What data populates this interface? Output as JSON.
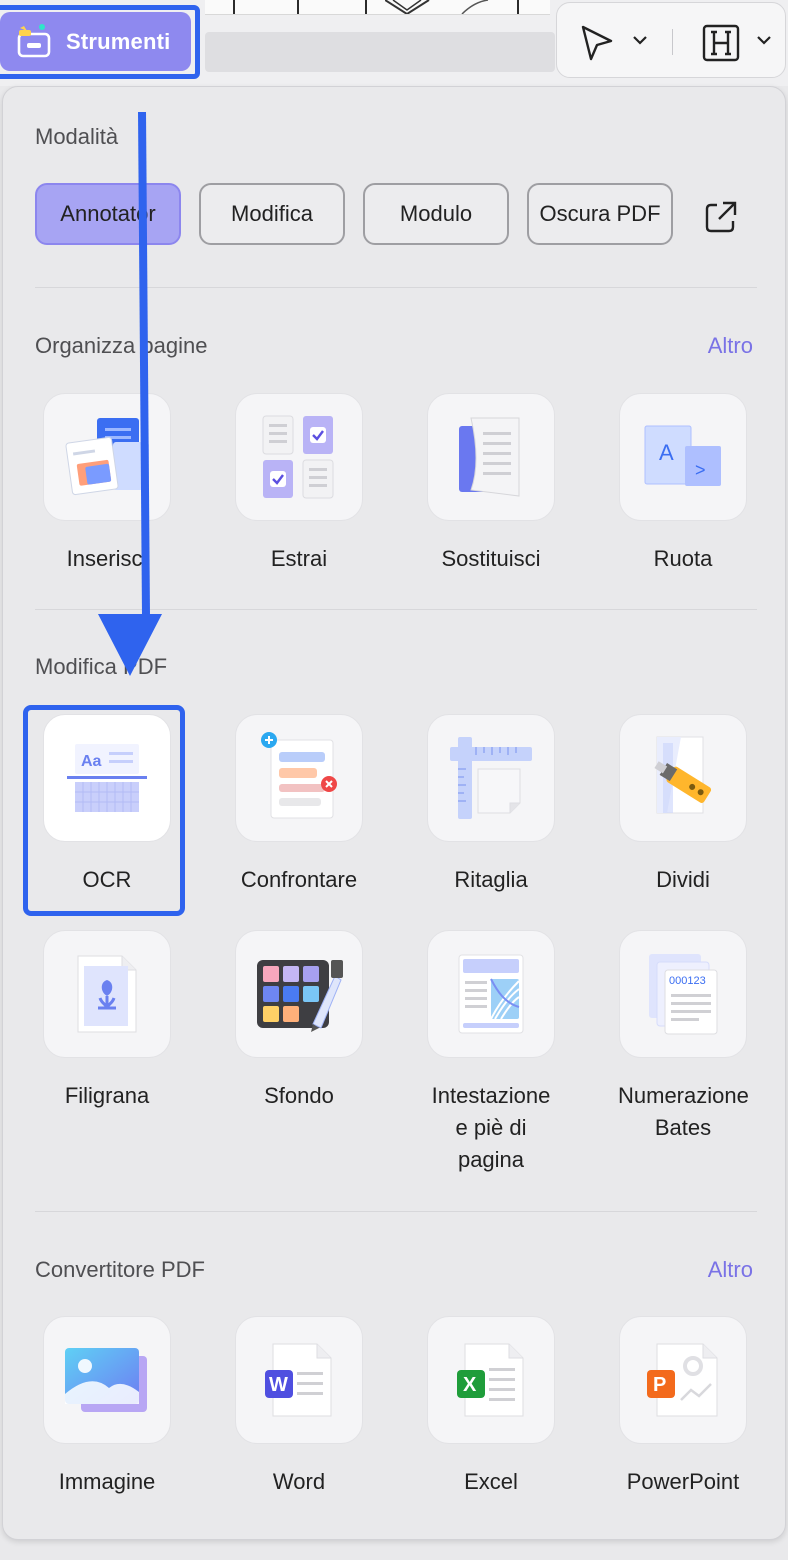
{
  "toolbar": {
    "strumenti_label": "Strumenti"
  },
  "panel": {
    "modes": {
      "title": "Modalità",
      "buttons": [
        "Annotator",
        "Modifica",
        "Modulo",
        "Oscura PDF"
      ],
      "active": "Annotator"
    },
    "organize": {
      "title": "Organizza pagine",
      "more": "Altro",
      "items": [
        "Inserisci",
        "Estrai",
        "Sostituisci",
        "Ruota"
      ]
    },
    "edit": {
      "title": "Modifica PDF",
      "items": [
        "OCR",
        "Confrontare",
        "Ritaglia",
        "Dividi",
        "Filigrana",
        "Sfondo",
        "Intestazione e piè di pagina",
        "Numerazione Bates"
      ]
    },
    "convert": {
      "title": "Convertitore PDF",
      "more": "Altro",
      "items": [
        "Immagine",
        "Word",
        "Excel",
        "PowerPoint"
      ]
    }
  },
  "icons": {
    "bates_number": "000123",
    "word_letter": "W",
    "excel_letter": "X",
    "ppt_letter": "P",
    "ocr_letters": "Aa",
    "rotate_letter": "A"
  },
  "colors": {
    "accent": "#8e89ef",
    "link": "#7a72e6",
    "highlight": "#2f63ee"
  }
}
